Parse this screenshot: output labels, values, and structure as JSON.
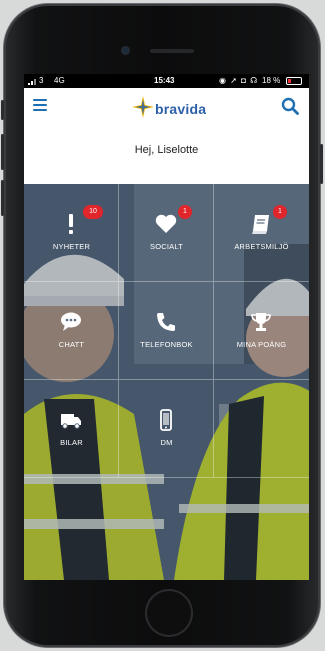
{
  "status_bar": {
    "signal": "3",
    "network": "4G",
    "time": "15:43",
    "battery": "18 %"
  },
  "header": {
    "logo_text": "bravida",
    "menu_icon": "menu-icon",
    "search_icon": "search-icon"
  },
  "greeting": "Hej, Liselotte",
  "tiles": [
    {
      "label": "NYHETER",
      "icon": "exclamation-icon",
      "badge": "10"
    },
    {
      "label": "SOCIALT",
      "icon": "heart-icon",
      "badge": "1"
    },
    {
      "label": "ARBETSMILJÖ",
      "icon": "book-icon",
      "badge": "1"
    },
    {
      "label": "CHATT",
      "icon": "chat-icon",
      "badge": ""
    },
    {
      "label": "TELEFONBOK",
      "icon": "phone-icon",
      "badge": ""
    },
    {
      "label": "MINA POÄNG",
      "icon": "trophy-icon",
      "badge": ""
    },
    {
      "label": "BILAR",
      "icon": "truck-icon",
      "badge": ""
    },
    {
      "label": "DM",
      "icon": "mobile-icon",
      "badge": ""
    }
  ],
  "colors": {
    "brand_blue": "#2b5fa8",
    "accent_blue": "#1f6fb3",
    "logo_yellow": "#f5b800",
    "badge_red": "#e0252b",
    "vest_yellow": "#d4e62a"
  }
}
